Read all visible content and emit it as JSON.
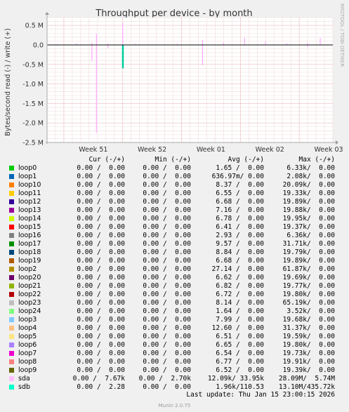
{
  "chart_data": {
    "type": "line",
    "title": "Throughput per device - by month",
    "ylabel": "Bytes/second read (-) / write (+)",
    "side_label": "RRDTOOL / TOBI OETIKER",
    "ylim": [
      -2500000,
      700000
    ],
    "yticks": [
      {
        "v": 500000,
        "label": "0.5 M"
      },
      {
        "v": 0,
        "label": "0.0"
      },
      {
        "v": -500000,
        "label": "-0.5 M"
      },
      {
        "v": -1000000,
        "label": "-1.0 M"
      },
      {
        "v": -1500000,
        "label": "-1.5 M"
      },
      {
        "v": -2000000,
        "label": "-2.0 M"
      },
      {
        "v": -2500000,
        "label": "-2.5 M"
      }
    ],
    "xlim": [
      "2025-12-13",
      "2026-01-16"
    ],
    "xticks": [
      {
        "date": "2025-12-15",
        "label": "Week 51"
      },
      {
        "date": "2025-12-22",
        "label": "Week 52"
      },
      {
        "date": "2025-12-29",
        "label": "Week 01"
      },
      {
        "date": "2026-01-05",
        "label": "Week 02"
      },
      {
        "date": "2026-01-12",
        "label": "Week 03"
      }
    ],
    "grid": true,
    "series": [
      {
        "name": "sda",
        "color": "#FFA8FF",
        "points": [
          {
            "x": "2025-12-14 06:00",
            "read": 0,
            "write": 20000
          },
          {
            "x": "2025-12-16 12:00",
            "read": 0,
            "write": 40000
          },
          {
            "x": "2025-12-18 08:00",
            "read": -420000,
            "write": 60000
          },
          {
            "x": "2025-12-18 21:00",
            "read": -2250000,
            "write": 280000
          },
          {
            "x": "2025-12-20 06:00",
            "read": -80000,
            "write": 30000
          },
          {
            "x": "2025-12-22 00:00",
            "read": -40000,
            "write": 560000
          },
          {
            "x": "2025-12-23 12:00",
            "read": 0,
            "write": 30000
          },
          {
            "x": "2025-12-28 12:00",
            "read": 0,
            "write": 30000
          },
          {
            "x": "2025-12-31 12:00",
            "read": -520000,
            "write": 130000
          },
          {
            "x": "2026-01-03 00:00",
            "read": 0,
            "write": 60000
          },
          {
            "x": "2026-01-05 12:00",
            "read": 0,
            "write": 180000
          },
          {
            "x": "2026-01-08 00:00",
            "read": 0,
            "write": 90000
          },
          {
            "x": "2026-01-10 12:00",
            "read": 0,
            "write": 40000
          },
          {
            "x": "2026-01-13 00:00",
            "read": -60000,
            "write": 50000
          },
          {
            "x": "2026-01-14 12:00",
            "read": 0,
            "write": 180000
          }
        ]
      },
      {
        "name": "sdb",
        "color": "#00CC99",
        "points": [
          {
            "x": "2025-12-22 00:00",
            "read": -600000,
            "write": 0
          }
        ]
      }
    ]
  },
  "legend": {
    "header": {
      "cur": "Cur (-/+)",
      "min": "Min (-/+)",
      "avg": "Avg (-/+)",
      "max": "Max (-/+)"
    },
    "rows": [
      {
        "name": "loop0",
        "color": "#00CC00",
        "cur": "0.00 /  0.00",
        "min": "0.00 /  0.00",
        "avg": "1.65 /  0.00",
        "max": "6.33k/  0.00"
      },
      {
        "name": "loop1",
        "color": "#0066B3",
        "cur": "0.00 /  0.00",
        "min": "0.00 /  0.00",
        "avg": "636.97m/ 0.00",
        "max": "2.08k/  0.00"
      },
      {
        "name": "loop10",
        "color": "#FF8000",
        "cur": "0.00 /  0.00",
        "min": "0.00 /  0.00",
        "avg": "8.37 /  0.00",
        "max": "20.09k/  0.00"
      },
      {
        "name": "loop11",
        "color": "#FFCC00",
        "cur": "0.00 /  0.00",
        "min": "0.00 /  0.00",
        "avg": "6.55 /  0.00",
        "max": "19.33k/  0.00"
      },
      {
        "name": "loop12",
        "color": "#330099",
        "cur": "0.00 /  0.00",
        "min": "0.00 /  0.00",
        "avg": "6.68 /  0.00",
        "max": "19.89k/  0.00"
      },
      {
        "name": "loop13",
        "color": "#990099",
        "cur": "0.00 /  0.00",
        "min": "0.00 /  0.00",
        "avg": "7.16 /  0.00",
        "max": "19.88k/  0.00"
      },
      {
        "name": "loop14",
        "color": "#CCFF00",
        "cur": "0.00 /  0.00",
        "min": "0.00 /  0.00",
        "avg": "6.78 /  0.00",
        "max": "19.95k/  0.00"
      },
      {
        "name": "loop15",
        "color": "#FF0000",
        "cur": "0.00 /  0.00",
        "min": "0.00 /  0.00",
        "avg": "6.41 /  0.00",
        "max": "19.37k/  0.00"
      },
      {
        "name": "loop16",
        "color": "#808080",
        "cur": "0.00 /  0.00",
        "min": "0.00 /  0.00",
        "avg": "2.93 /  0.00",
        "max": "6.36k/  0.00"
      },
      {
        "name": "loop17",
        "color": "#008F00",
        "cur": "0.00 /  0.00",
        "min": "0.00 /  0.00",
        "avg": "9.57 /  0.00",
        "max": "31.71k/  0.00"
      },
      {
        "name": "loop18",
        "color": "#00487D",
        "cur": "0.00 /  0.00",
        "min": "0.00 /  0.00",
        "avg": "8.84 /  0.00",
        "max": "19.79k/  0.00"
      },
      {
        "name": "loop19",
        "color": "#B35A00",
        "cur": "0.00 /  0.00",
        "min": "0.00 /  0.00",
        "avg": "6.68 /  0.00",
        "max": "19.89k/  0.00"
      },
      {
        "name": "loop2",
        "color": "#B38F00",
        "cur": "0.00 /  0.00",
        "min": "0.00 /  0.00",
        "avg": "27.14 /  0.00",
        "max": "61.87k/  0.00"
      },
      {
        "name": "loop20",
        "color": "#6B006B",
        "cur": "0.00 /  0.00",
        "min": "0.00 /  0.00",
        "avg": "6.62 /  0.00",
        "max": "19.69k/  0.00"
      },
      {
        "name": "loop21",
        "color": "#8FB300",
        "cur": "0.00 /  0.00",
        "min": "0.00 /  0.00",
        "avg": "6.82 /  0.00",
        "max": "19.77k/  0.00"
      },
      {
        "name": "loop22",
        "color": "#B30000",
        "cur": "0.00 /  0.00",
        "min": "0.00 /  0.00",
        "avg": "6.72 /  0.00",
        "max": "19.80k/  0.00"
      },
      {
        "name": "loop23",
        "color": "#BEBEBE",
        "cur": "0.00 /  0.00",
        "min": "0.00 /  0.00",
        "avg": "8.14 /  0.00",
        "max": "65.19k/  0.00"
      },
      {
        "name": "loop24",
        "color": "#80FF80",
        "cur": "0.00 /  0.00",
        "min": "0.00 /  0.00",
        "avg": "1.64 /  0.00",
        "max": "3.52k/  0.00"
      },
      {
        "name": "loop3",
        "color": "#80C9FF",
        "cur": "0.00 /  0.00",
        "min": "0.00 /  0.00",
        "avg": "7.99 /  0.00",
        "max": "19.68k/  0.00"
      },
      {
        "name": "loop4",
        "color": "#FFC080",
        "cur": "0.00 /  0.00",
        "min": "0.00 /  0.00",
        "avg": "12.60 /  0.00",
        "max": "31.37k/  0.00"
      },
      {
        "name": "loop5",
        "color": "#FFE680",
        "cur": "0.00 /  0.00",
        "min": "0.00 /  0.00",
        "avg": "6.51 /  0.00",
        "max": "19.59k/  0.00"
      },
      {
        "name": "loop6",
        "color": "#AA80FF",
        "cur": "0.00 /  0.00",
        "min": "0.00 /  0.00",
        "avg": "6.65 /  0.00",
        "max": "19.80k/  0.00"
      },
      {
        "name": "loop7",
        "color": "#EE00CC",
        "cur": "0.00 /  0.00",
        "min": "0.00 /  0.00",
        "avg": "6.54 /  0.00",
        "max": "19.73k/  0.00"
      },
      {
        "name": "loop8",
        "color": "#FF8080",
        "cur": "0.00 /  0.00",
        "min": "0.00 /  0.00",
        "avg": "6.77 /  0.00",
        "max": "19.91k/  0.00"
      },
      {
        "name": "loop9",
        "color": "#666600",
        "cur": "0.00 /  0.00",
        "min": "0.00 /  0.00",
        "avg": "6.52 /  0.00",
        "max": "19.39k/  0.00"
      },
      {
        "name": "sda",
        "color": "#FFBFFF",
        "cur": "0.00 /  7.67k",
        "min": "0.00 /  2.70k",
        "avg": "12.09k/ 33.95k",
        "max": "28.09M/  5.74M"
      },
      {
        "name": "sdb",
        "color": "#00FFCC",
        "cur": "0.00 /  2.28",
        "min": "0.00 /  0.00",
        "avg": "1.96k/110.53",
        "max": "13.10M/435.72k"
      }
    ]
  },
  "footer": {
    "last_update": "Last update: Thu Jan 15 23:00:15 2026",
    "munin_version": "Munin 2.0.75"
  }
}
